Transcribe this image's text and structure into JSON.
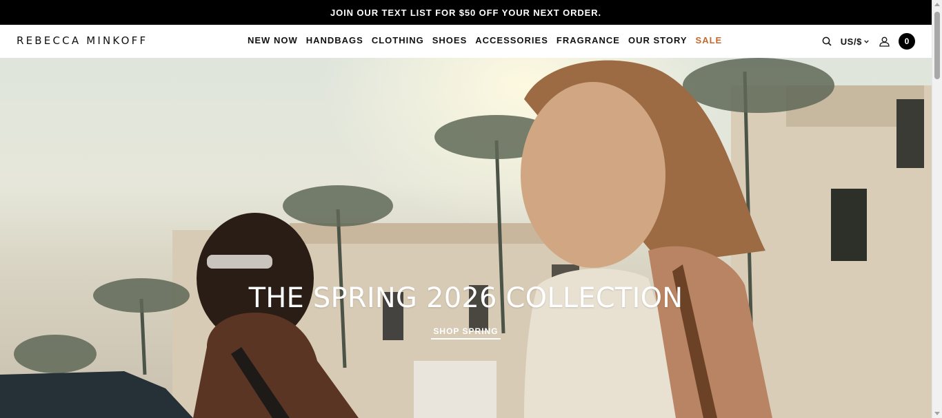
{
  "promo": {
    "text": "JOIN OUR TEXT LIST FOR $50 OFF YOUR NEXT ORDER."
  },
  "header": {
    "logo": "REBECCA MINKOFF",
    "nav": [
      {
        "label": "NEW NOW"
      },
      {
        "label": "HANDBAGS"
      },
      {
        "label": "CLOTHING"
      },
      {
        "label": "SHOES"
      },
      {
        "label": "ACCESSORIES"
      },
      {
        "label": "FRAGRANCE"
      },
      {
        "label": "OUR STORY"
      },
      {
        "label": "SALE"
      }
    ],
    "currency": "US/$",
    "cart_count": "0",
    "icons": {
      "search": "search-icon",
      "account": "user-icon",
      "currency": "chevron-down-icon"
    }
  },
  "hero": {
    "title": "THE SPRING 2026 COLLECTION",
    "cta": "SHOP SPRING"
  },
  "colors": {
    "sale": "#c26a2d",
    "promo_bg": "#000000"
  }
}
